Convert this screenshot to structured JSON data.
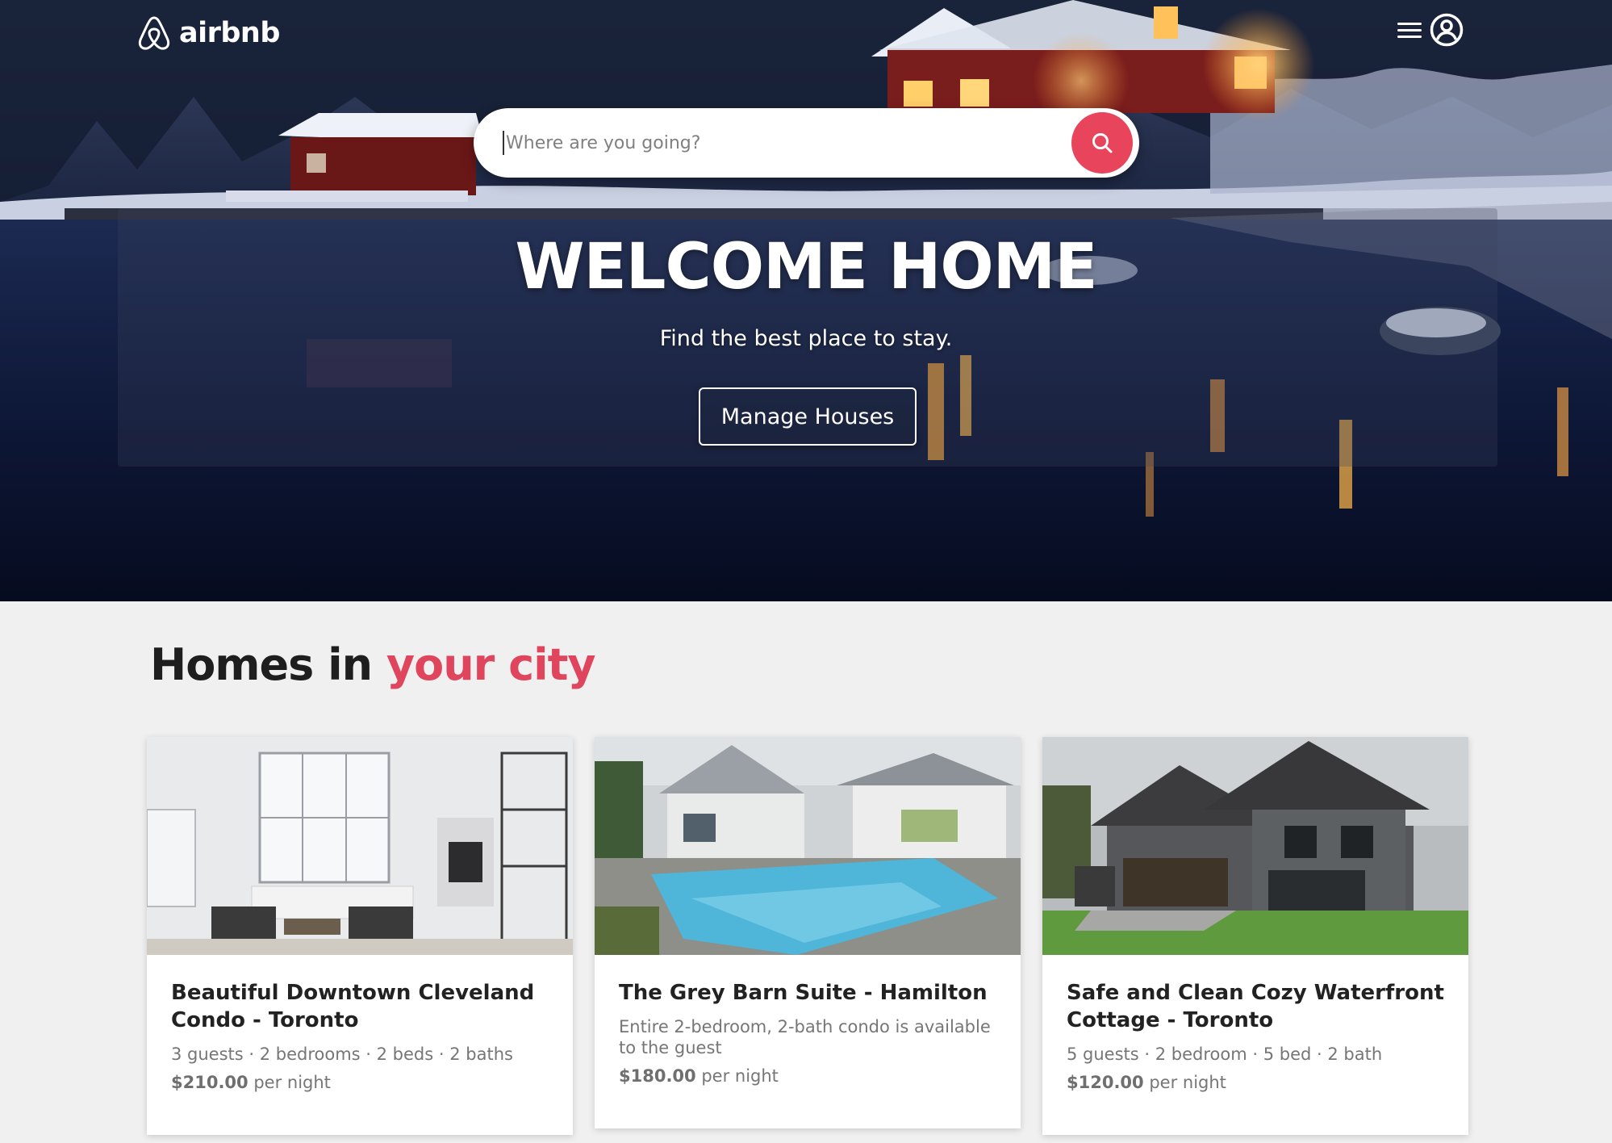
{
  "brand": {
    "name": "airbnb"
  },
  "search": {
    "placeholder": "Where are you going?"
  },
  "hero": {
    "title": "WELCOME HOME",
    "subtitle": "Find the best place to stay.",
    "button_label": "Manage Houses"
  },
  "section": {
    "title_prefix": "Homes in ",
    "title_accent": "your city"
  },
  "listings": [
    {
      "title": "Beautiful Downtown Cleveland Condo - Toronto",
      "details": "3 guests · 2 bedrooms · 2 beds · 2 baths",
      "price": "$210.00",
      "price_unit": "per night"
    },
    {
      "title": "The Grey Barn Suite - Hamilton",
      "details": "Entire 2-bedroom, 2-bath condo is available to the guest",
      "price": "$180.00",
      "price_unit": "per night"
    },
    {
      "title": "Safe and Clean Cozy Waterfront Cottage - Toronto",
      "details": "5 guests · 2 bedroom · 5 bed · 2 bath",
      "price": "$120.00",
      "price_unit": "per night"
    }
  ],
  "icons": {
    "logo": "airbnb-belo-icon",
    "menu": "hamburger-menu-icon",
    "account": "user-account-icon",
    "search": "search-icon"
  },
  "colors": {
    "brand_accent": "#e0455e",
    "search_button": "#e8455d",
    "page_background": "#f0f0f0"
  }
}
